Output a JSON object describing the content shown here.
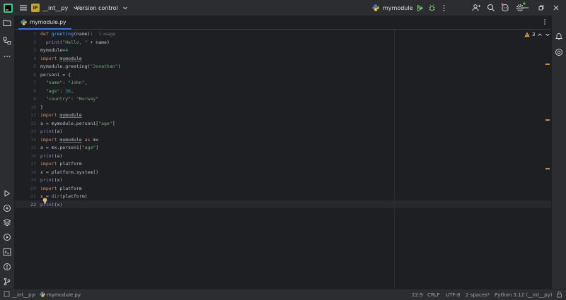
{
  "titlebar": {
    "project_badge": "IP",
    "project_name": "__int__py",
    "vcs_label": "Version control",
    "run_config": "mymodule"
  },
  "tab": {
    "label": "mymodule.py"
  },
  "inspections": {
    "warnings": "3"
  },
  "gutter": {
    "lines": [
      "1",
      "2",
      "3",
      "4",
      "5",
      "6",
      "7",
      "8",
      "9",
      "10",
      "11",
      "12",
      "13",
      "14",
      "15",
      "16",
      "17",
      "18",
      "19",
      "20",
      "21",
      "22"
    ],
    "current_line": "22"
  },
  "code": {
    "usage_hint": "1 usage",
    "l1_def": "def",
    "l1_fn": "greeting",
    "l1_rest": "(name):",
    "l2_a": "  ",
    "l2_print": "print",
    "l2_b": "(",
    "l2_str": "\"Hello, \"",
    "l2_c": " + name)",
    "l3_a": "mymodule=",
    "l3_num": "4",
    "l4_kw": "import",
    "l4_mod": "mymodule",
    "l5": "mymodule.greeting(",
    "l5_str": "\"Jonathan\"",
    "l5_end": ")",
    "l6": "person1 = {",
    "l7_key": "\"name\"",
    "l7_colon": ": ",
    "l7_val": "\"John\"",
    "l7_end": ",",
    "l8_key": "\"age\"",
    "l8_colon": ": ",
    "l8_val": "36",
    "l8_end": ",",
    "l9_key": "\"country\"",
    "l9_colon": ": ",
    "l9_val": "\"Norway\"",
    "l10": "}",
    "l11_kw": "import",
    "l11_mod": "mymodule",
    "l12_a": "a = mymodule.person1[",
    "l12_str": "\"age\"",
    "l12_end": "]",
    "l13_print": "print",
    "l13_rest": "(a)",
    "l14_kw": "import",
    "l14_mod": "mymodule",
    "l14_as": "as",
    "l14_alias": "mx",
    "l15_a": "a = mx.person1[",
    "l15_str": "\"age\"",
    "l15_end": "]",
    "l16_print": "print",
    "l16_rest": "(a)",
    "l17_kw": "import",
    "l17_mod": "platform",
    "l18": "x = platform.system()",
    "l19_print": "print",
    "l19_rest": "(x)",
    "l20_kw": "import",
    "l20_mod": "platform",
    "l21_a": "x",
    "l21_b": "= ",
    "l21_dir": "dir",
    "l21_rest": "(platform)",
    "l22_print": "print",
    "l22_rest": "(x)"
  },
  "statusbar": {
    "breadcrumb_project": "__int__py",
    "breadcrumb_file": "mymodule.py",
    "position": "22:9",
    "line_separator": "CRLF",
    "encoding": "UTF-8",
    "indent": "2 spaces*",
    "interpreter": "Python 3.12 (__int__py)"
  },
  "colors": {
    "accent": "#3574f0",
    "run_green": "#5fb865",
    "warning": "#e5a330",
    "background": "#1e1f22",
    "panel": "#2b2d30"
  },
  "icons": [
    "app-logo-icon",
    "hamburger-icon",
    "chevron-down-icon",
    "python-icon",
    "run-icon",
    "debug-icon",
    "more-icon",
    "add-user-icon",
    "search-icon",
    "copilot-icon",
    "gear-icon",
    "minimize-icon",
    "restore-icon",
    "close-icon",
    "folder-icon",
    "structure-icon",
    "ellipsis-icon",
    "run-tool-icon",
    "python-console-icon",
    "layers-icon",
    "services-icon",
    "terminal-icon",
    "problems-icon",
    "git-icon",
    "notifications-icon",
    "ai-assistant-icon",
    "warning-icon",
    "arrow-up-icon",
    "arrow-down-icon",
    "bulb-icon"
  ]
}
